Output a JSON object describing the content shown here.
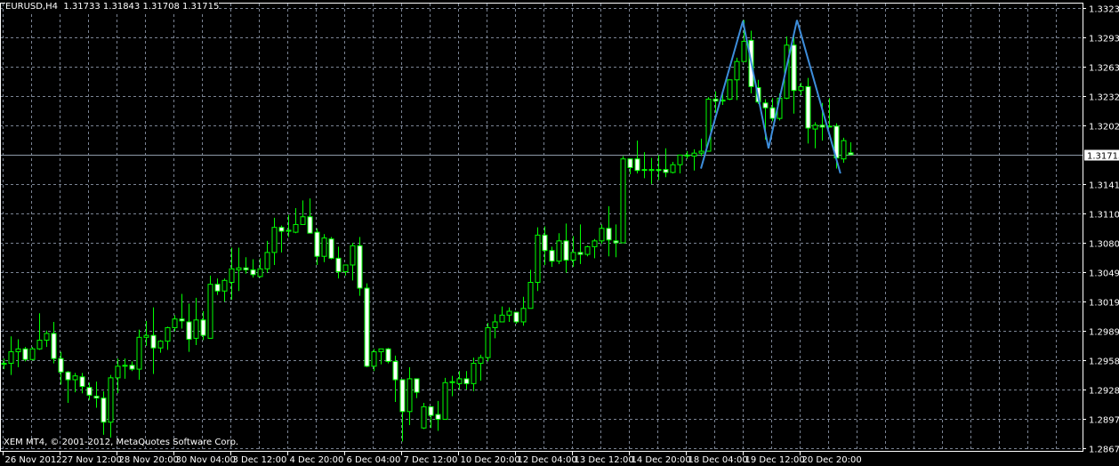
{
  "header": {
    "symbol": "EURUSD,H4",
    "open": "1.31733",
    "high": "1.31843",
    "low": "1.31708",
    "close": "1.31715"
  },
  "copyright": "XEM MT4, © 2001-2012, MetaQuotes Software Corp.",
  "colors": {
    "background": "#000000",
    "candle_outline": "#00ff00",
    "bull_body": "#000000",
    "bear_body": "#ffffff",
    "grid": "#7b8494",
    "pattern_line": "#3d8ddb",
    "price_line": "#8d9aa8"
  },
  "chart_data": {
    "type": "candlestick",
    "title": "EURUSD,H4",
    "timeframe": "H4",
    "ylim": [
      1.2867,
      1.33235
    ],
    "y_ticks": [
      "1.33235",
      "1.32935",
      "1.32630",
      "1.32325",
      "1.32020",
      "1.31715",
      "1.31410",
      "1.31105",
      "1.30800",
      "1.30495",
      "1.30195",
      "1.29890",
      "1.29585",
      "1.29280",
      "1.28975",
      "1.28670"
    ],
    "current_price": "1.31715",
    "x_tick_labels": [
      {
        "bar": 0,
        "label": "26 Nov 2012"
      },
      {
        "bar": 8,
        "label": "27 Nov 12:00"
      },
      {
        "bar": 16,
        "label": "28 Nov 20:00"
      },
      {
        "bar": 24,
        "label": "30 Nov 04:00"
      },
      {
        "bar": 32,
        "label": "3 Dec 12:00"
      },
      {
        "bar": 40,
        "label": "4 Dec 20:00"
      },
      {
        "bar": 48,
        "label": "6 Dec 04:00"
      },
      {
        "bar": 56,
        "label": "7 Dec 12:00"
      },
      {
        "bar": 64,
        "label": "10 Dec 20:00"
      },
      {
        "bar": 72,
        "label": "12 Dec 04:00"
      },
      {
        "bar": 80,
        "label": "13 Dec 12:00"
      },
      {
        "bar": 88,
        "label": "14 Dec 20:00"
      },
      {
        "bar": 96,
        "label": "18 Dec 04:00"
      },
      {
        "bar": 104,
        "label": "19 Dec 12:00"
      },
      {
        "bar": 112,
        "label": "20 Dec 20:00"
      }
    ],
    "grid": true,
    "ohlc": [
      [
        1.2954,
        1.296,
        1.2949,
        1.2955
      ],
      [
        1.2955,
        1.2983,
        1.2943,
        1.2967
      ],
      [
        1.2967,
        1.298,
        1.2951,
        1.297
      ],
      [
        1.297,
        1.2972,
        1.2957,
        1.2959
      ],
      [
        1.2959,
        1.2972,
        1.2958,
        1.297
      ],
      [
        1.297,
        1.3007,
        1.2969,
        1.2979
      ],
      [
        1.2979,
        1.2989,
        1.2972,
        1.2986
      ],
      [
        1.2986,
        1.2998,
        1.2955,
        1.296
      ],
      [
        1.296,
        1.2967,
        1.2933,
        1.2946
      ],
      [
        1.2946,
        1.2947,
        1.2914,
        1.2938
      ],
      [
        1.2938,
        1.2945,
        1.2925,
        1.2942
      ],
      [
        1.2941,
        1.2945,
        1.2924,
        1.2931
      ],
      [
        1.293,
        1.2935,
        1.2917,
        1.2922
      ],
      [
        1.2921,
        1.2936,
        1.2909,
        1.2919
      ],
      [
        1.2919,
        1.2926,
        1.2881,
        1.2894
      ],
      [
        1.2894,
        1.2943,
        1.2878,
        1.294
      ],
      [
        1.294,
        1.296,
        1.2924,
        1.2952
      ],
      [
        1.2952,
        1.296,
        1.2939,
        1.2953
      ],
      [
        1.2953,
        1.2957,
        1.2947,
        1.2949
      ],
      [
        1.2949,
        1.299,
        1.2938,
        1.2982
      ],
      [
        1.2982,
        1.2999,
        1.2973,
        1.2984
      ],
      [
        1.2984,
        1.3013,
        1.2944,
        1.2971
      ],
      [
        1.2971,
        1.2979,
        1.2966,
        1.2978
      ],
      [
        1.2978,
        1.2993,
        1.2969,
        1.2992
      ],
      [
        1.2992,
        1.3005,
        1.2988,
        1.3001
      ],
      [
        1.3001,
        1.3027,
        1.2991,
        1.2999
      ],
      [
        1.2998,
        1.3017,
        1.2967,
        1.298
      ],
      [
        1.2981,
        1.3023,
        1.2974,
        1.3
      ],
      [
        1.3,
        1.3009,
        1.2979,
        1.2984
      ],
      [
        1.2981,
        1.3046,
        1.2981,
        1.3037
      ],
      [
        1.3037,
        1.3043,
        1.3026,
        1.303
      ],
      [
        1.303,
        1.3043,
        1.3019,
        1.3041
      ],
      [
        1.3039,
        1.3075,
        1.3021,
        1.3053
      ],
      [
        1.3052,
        1.3075,
        1.303,
        1.3054
      ],
      [
        1.3054,
        1.3065,
        1.3048,
        1.3052
      ],
      [
        1.3052,
        1.3063,
        1.3044,
        1.3047
      ],
      [
        1.3045,
        1.3064,
        1.3044,
        1.3053
      ],
      [
        1.3053,
        1.3082,
        1.3049,
        1.307
      ],
      [
        1.307,
        1.3106,
        1.3057,
        1.3096
      ],
      [
        1.3096,
        1.3098,
        1.307,
        1.3092
      ],
      [
        1.3092,
        1.3109,
        1.3086,
        1.3093
      ],
      [
        1.3091,
        1.3116,
        1.309,
        1.3099
      ],
      [
        1.3099,
        1.3124,
        1.3099,
        1.3107
      ],
      [
        1.3107,
        1.3126,
        1.309,
        1.309
      ],
      [
        1.3091,
        1.3095,
        1.3057,
        1.3066
      ],
      [
        1.3066,
        1.3089,
        1.306,
        1.3085
      ],
      [
        1.3084,
        1.3086,
        1.3063,
        1.3064
      ],
      [
        1.3064,
        1.3076,
        1.3043,
        1.305
      ],
      [
        1.305,
        1.3057,
        1.3046,
        1.3057
      ],
      [
        1.3057,
        1.308,
        1.3041,
        1.3077
      ],
      [
        1.3077,
        1.3086,
        1.3025,
        1.3033
      ],
      [
        1.3033,
        1.3038,
        1.2951,
        1.2952
      ],
      [
        1.2952,
        1.297,
        1.2947,
        1.2967
      ],
      [
        1.2967,
        1.297,
        1.2954,
        1.297
      ],
      [
        1.297,
        1.2971,
        1.2955,
        1.2957
      ],
      [
        1.2957,
        1.2963,
        1.2915,
        1.2938
      ],
      [
        1.2938,
        1.2938,
        1.2874,
        1.2905
      ],
      [
        1.2905,
        1.2951,
        1.2891,
        1.2939
      ],
      [
        1.2939,
        1.2939,
        1.2919,
        1.2925
      ],
      [
        1.2888,
        1.2914,
        1.2887,
        1.291
      ],
      [
        1.291,
        1.291,
        1.2888,
        1.2901
      ],
      [
        1.2902,
        1.2916,
        1.2885,
        1.2897
      ],
      [
        1.2897,
        1.294,
        1.2897,
        1.2935
      ],
      [
        1.2935,
        1.2942,
        1.2921,
        1.2936
      ],
      [
        1.2934,
        1.2947,
        1.2928,
        1.2939
      ],
      [
        1.2939,
        1.2947,
        1.2928,
        1.2934
      ],
      [
        1.2934,
        1.2961,
        1.2926,
        1.2955
      ],
      [
        1.2955,
        1.2964,
        1.2937,
        1.2961
      ],
      [
        1.2961,
        1.2997,
        1.2957,
        1.2992
      ],
      [
        1.2992,
        1.3006,
        1.2981,
        1.2998
      ],
      [
        1.2998,
        1.3014,
        1.2998,
        1.3005
      ],
      [
        1.3005,
        1.3013,
        1.2998,
        1.3009
      ],
      [
        1.3008,
        1.3008,
        1.2996,
        1.2998
      ],
      [
        1.2998,
        1.3024,
        1.2994,
        1.3012
      ],
      [
        1.3012,
        1.3052,
        1.3012,
        1.3039
      ],
      [
        1.3039,
        1.3096,
        1.303,
        1.3088
      ],
      [
        1.3088,
        1.3097,
        1.3057,
        1.3072
      ],
      [
        1.3072,
        1.3076,
        1.3055,
        1.3061
      ],
      [
        1.3061,
        1.309,
        1.3058,
        1.3082
      ],
      [
        1.3082,
        1.31,
        1.3049,
        1.3062
      ],
      [
        1.3062,
        1.3087,
        1.3055,
        1.307
      ],
      [
        1.307,
        1.3099,
        1.3058,
        1.3068
      ],
      [
        1.3068,
        1.3077,
        1.3066,
        1.3076
      ],
      [
        1.3076,
        1.3084,
        1.3064,
        1.3082
      ],
      [
        1.3082,
        1.3099,
        1.3079,
        1.3095
      ],
      [
        1.3095,
        1.3118,
        1.3066,
        1.3083
      ],
      [
        1.3082,
        1.3099,
        1.3065,
        1.308
      ],
      [
        1.308,
        1.317,
        1.308,
        1.3167
      ],
      [
        1.3167,
        1.3167,
        1.3151,
        1.3158
      ],
      [
        1.3167,
        1.3186,
        1.3152,
        1.3155
      ],
      [
        1.3156,
        1.3174,
        1.3147,
        1.3156
      ],
      [
        1.3155,
        1.3168,
        1.3141,
        1.3156
      ],
      [
        1.3156,
        1.3171,
        1.3145,
        1.3155
      ],
      [
        1.3156,
        1.3178,
        1.3148,
        1.3153
      ],
      [
        1.3153,
        1.3164,
        1.3152,
        1.3161
      ],
      [
        1.3161,
        1.3171,
        1.3152,
        1.3171
      ],
      [
        1.3171,
        1.3175,
        1.3167,
        1.317
      ],
      [
        1.317,
        1.3177,
        1.3155,
        1.3173
      ],
      [
        1.3173,
        1.3188,
        1.317,
        1.3175
      ],
      [
        1.3175,
        1.3231,
        1.3175,
        1.3229
      ],
      [
        1.3229,
        1.3237,
        1.3215,
        1.3227
      ],
      [
        1.3227,
        1.3234,
        1.3223,
        1.3228
      ],
      [
        1.3229,
        1.3249,
        1.3228,
        1.3249
      ],
      [
        1.3249,
        1.3272,
        1.3228,
        1.3268
      ],
      [
        1.3268,
        1.3311,
        1.3268,
        1.3289
      ],
      [
        1.329,
        1.33,
        1.3235,
        1.3242
      ],
      [
        1.3241,
        1.3249,
        1.3224,
        1.3226
      ],
      [
        1.3225,
        1.3229,
        1.3187,
        1.322
      ],
      [
        1.322,
        1.323,
        1.3206,
        1.3209
      ],
      [
        1.3209,
        1.3235,
        1.3207,
        1.323
      ],
      [
        1.323,
        1.3294,
        1.3229,
        1.3285
      ],
      [
        1.3285,
        1.3295,
        1.3214,
        1.3238
      ],
      [
        1.3238,
        1.3246,
        1.3233,
        1.3242
      ],
      [
        1.3242,
        1.3251,
        1.3183,
        1.3199
      ],
      [
        1.3198,
        1.3205,
        1.3178,
        1.3202
      ],
      [
        1.3202,
        1.3225,
        1.3186,
        1.32
      ],
      [
        1.3201,
        1.323,
        1.32,
        1.3201
      ],
      [
        1.3201,
        1.3204,
        1.3157,
        1.3168
      ],
      [
        1.3167,
        1.3189,
        1.3163,
        1.3186
      ],
      [
        1.31733,
        1.31843,
        1.31708,
        1.31715
      ]
    ],
    "annotations": [
      {
        "type": "polyline",
        "name": "double-top-pattern",
        "points": [
          [
            98,
            1.3157
          ],
          [
            103.9,
            1.331
          ],
          [
            107.5,
            1.3178
          ],
          [
            111.5,
            1.3311
          ],
          [
            117.6,
            1.3152
          ]
        ]
      }
    ]
  }
}
